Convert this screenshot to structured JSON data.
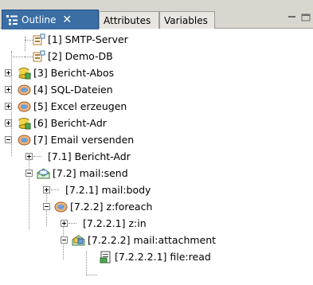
{
  "tabs": [
    {
      "label": "Outline",
      "active": true,
      "icon": "outline-icon"
    },
    {
      "label": "Attributes",
      "active": false
    },
    {
      "label": "Variables",
      "active": false
    }
  ],
  "tree": [
    {
      "label": "[1] SMTP-Server",
      "icon": "server-icon",
      "expander": "none"
    },
    {
      "label": "[2] Demo-DB",
      "icon": "database-icon",
      "expander": "none"
    },
    {
      "label": "[3] Bericht-Abos",
      "icon": "report-icon",
      "expander": "plus"
    },
    {
      "label": "[4] SQL-Dateien",
      "icon": "sql-icon",
      "expander": "plus"
    },
    {
      "label": "[5] Excel erzeugen",
      "icon": "sql-icon",
      "expander": "plus"
    },
    {
      "label": "[6] Bericht-Adr",
      "icon": "report-icon",
      "expander": "plus"
    },
    {
      "label": "[7] Email versenden",
      "icon": "sql-icon",
      "expander": "minus"
    },
    {
      "label": "[7.1] Bericht-Adr",
      "icon": "",
      "expander": "plus"
    },
    {
      "label": "[7.2] mail:send",
      "icon": "mail-icon",
      "expander": "minus"
    },
    {
      "label": "[7.2.1] mail:body",
      "icon": "",
      "expander": "plus"
    },
    {
      "label": "[7.2.2] z:foreach",
      "icon": "sql-icon",
      "expander": "minus"
    },
    {
      "label": "[7.2.2.1] z:in",
      "icon": "",
      "expander": "plus"
    },
    {
      "label": "[7.2.2.2] mail:attachment",
      "icon": "attachment-icon",
      "expander": "minus"
    },
    {
      "label": "[7.2.2.2.1] file:read",
      "icon": "file-icon",
      "expander": "none"
    }
  ],
  "colors": {
    "active_tab": "#3a6ea5",
    "tab_bar": "#d9d5cf"
  }
}
